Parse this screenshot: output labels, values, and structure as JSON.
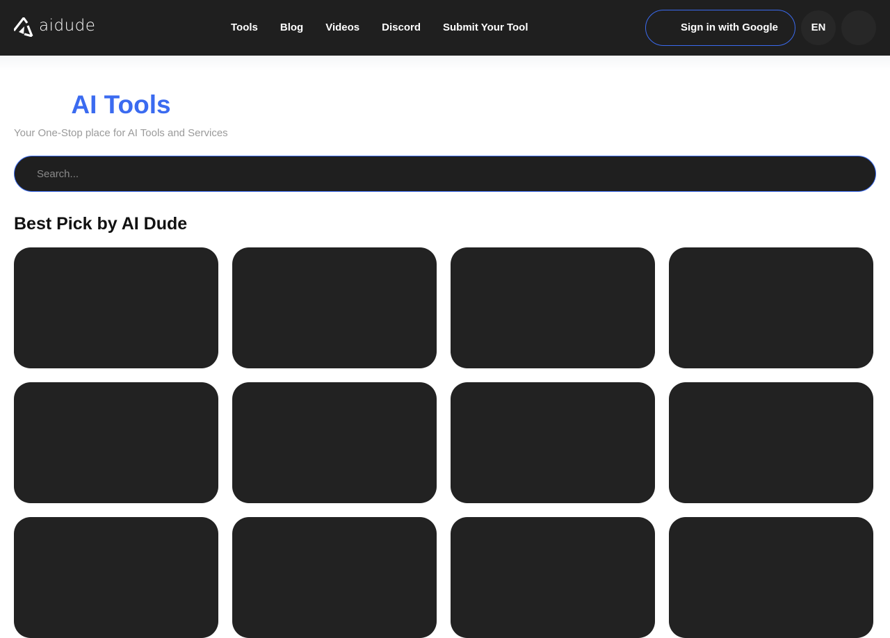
{
  "header": {
    "logo_text": "aidude",
    "nav": [
      "Tools",
      "Blog",
      "Videos",
      "Discord",
      "Submit Your Tool"
    ],
    "signin_label": "Sign in with Google",
    "language": "EN"
  },
  "hero": {
    "title": "AI Tools",
    "subtitle": "Your One-Stop place for AI Tools and Services"
  },
  "search": {
    "placeholder": "Search...",
    "value": ""
  },
  "section": {
    "title": "Best Pick by AI Dude"
  },
  "colors": {
    "accent": "#3b6bf0",
    "header_bg": "#1f1f1f",
    "card_bg": "#222222",
    "subtitle": "#9a9a9a"
  },
  "icons": {
    "logo": "aidude-logo-icon"
  }
}
